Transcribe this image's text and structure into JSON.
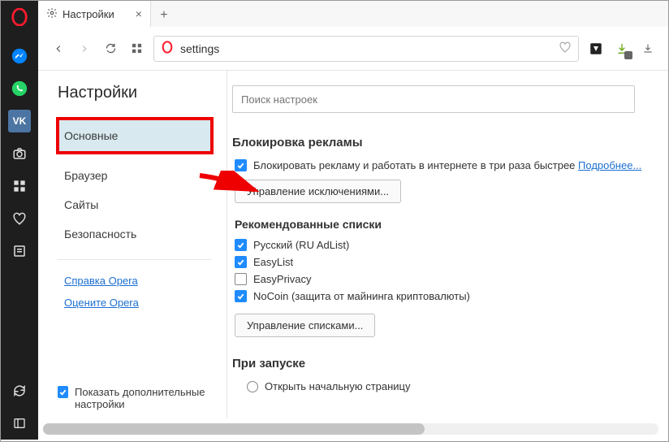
{
  "tab": {
    "title": "Настройки"
  },
  "address": {
    "value": "settings"
  },
  "sidebar": {
    "title": "Настройки",
    "items": [
      {
        "label": "Основные",
        "active": true
      },
      {
        "label": "Браузер"
      },
      {
        "label": "Сайты"
      },
      {
        "label": "Безопасность"
      }
    ],
    "help_link": "Справка Opera",
    "rate_link": "Оцените Opera",
    "advanced": {
      "label": "Показать дополнительные настройки",
      "checked": true
    }
  },
  "main": {
    "search_placeholder": "Поиск настроек",
    "adblock": {
      "title": "Блокировка рекламы",
      "option_label": "Блокировать рекламу и работать в интернете в три раза быстрее",
      "option_checked": true,
      "more_label": "Подробнее...",
      "exceptions_btn": "Управление исключениями...",
      "lists_title": "Рекомендованные списки",
      "lists": [
        {
          "label": "Русский (RU AdList)",
          "checked": true
        },
        {
          "label": "EasyList",
          "checked": true
        },
        {
          "label": "EasyPrivacy",
          "checked": false
        },
        {
          "label": "NoCoin (защита от майнинга криптовалюты)",
          "checked": true
        }
      ],
      "manage_lists_btn": "Управление списками..."
    },
    "startup": {
      "title": "При запуске",
      "options": [
        {
          "label": "Открыть начальную страницу",
          "checked": false
        }
      ]
    }
  }
}
